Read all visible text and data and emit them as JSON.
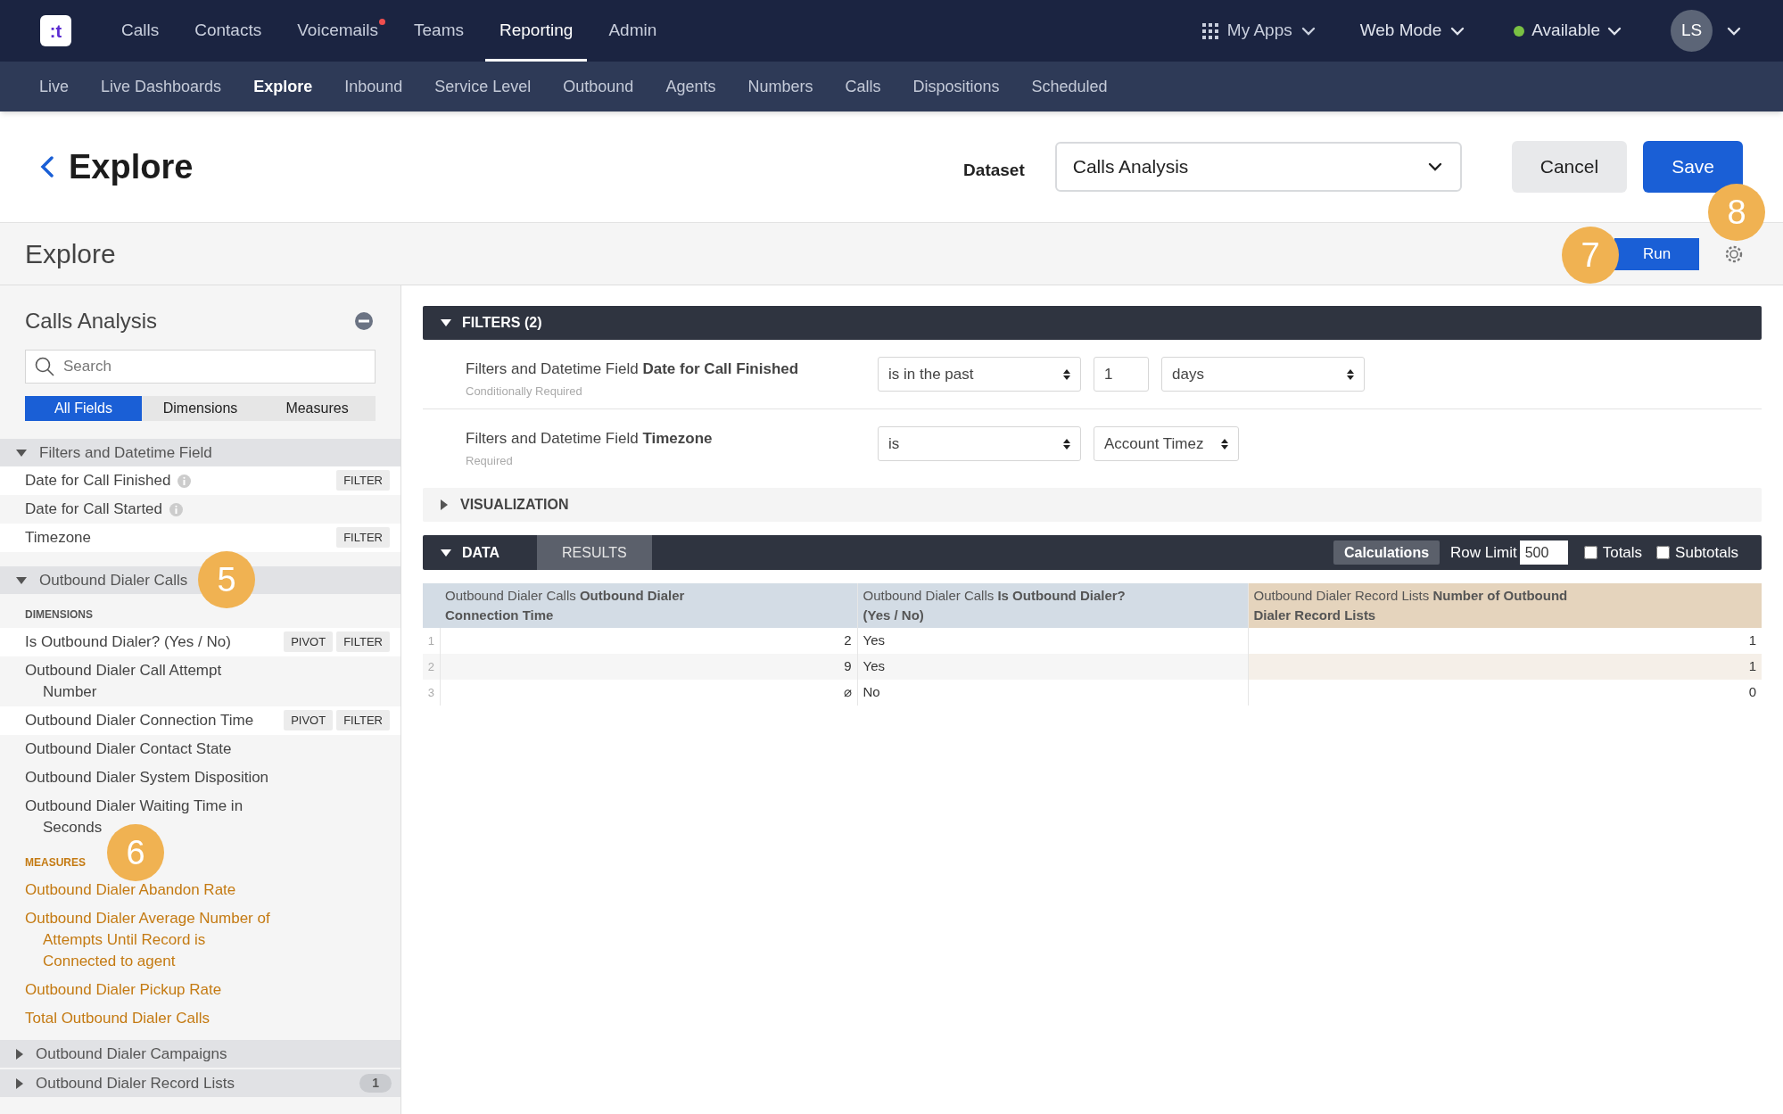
{
  "top_nav": {
    "logo_text": ":t",
    "items": [
      {
        "label": "Calls",
        "selected": false,
        "notification": false
      },
      {
        "label": "Contacts",
        "selected": false,
        "notification": false
      },
      {
        "label": "Voicemails",
        "selected": false,
        "notification": true
      },
      {
        "label": "Teams",
        "selected": false,
        "notification": false
      },
      {
        "label": "Reporting",
        "selected": true,
        "notification": false
      },
      {
        "label": "Admin",
        "selected": false,
        "notification": false
      }
    ],
    "apps": "My Apps",
    "mode": "Web Mode",
    "status": {
      "label": "Available",
      "color": "#7ac143"
    },
    "avatar": "LS"
  },
  "sub_nav": {
    "items": [
      {
        "label": "Live",
        "selected": false
      },
      {
        "label": "Live Dashboards",
        "selected": false
      },
      {
        "label": "Explore",
        "selected": true
      },
      {
        "label": "Inbound",
        "selected": false
      },
      {
        "label": "Service Level",
        "selected": false
      },
      {
        "label": "Outbound",
        "selected": false
      },
      {
        "label": "Agents",
        "selected": false
      },
      {
        "label": "Numbers",
        "selected": false
      },
      {
        "label": "Calls",
        "selected": false
      },
      {
        "label": "Dispositions",
        "selected": false
      },
      {
        "label": "Scheduled",
        "selected": false
      }
    ]
  },
  "page_header": {
    "title": "Explore",
    "dataset_label": "Dataset",
    "dataset_value": "Calls Analysis",
    "buttons": [
      {
        "label": "Cancel",
        "kind": "secondary"
      },
      {
        "label": "Save",
        "kind": "primary"
      }
    ]
  },
  "toolbar": {
    "title": "Explore",
    "run_button": "Run"
  },
  "sidebar": {
    "title": "Calls Analysis",
    "search": {
      "placeholder": "Search"
    },
    "tabs": [
      {
        "label": "All Fields",
        "selected": true
      },
      {
        "label": "Dimensions",
        "selected": false
      },
      {
        "label": "Measures",
        "selected": false
      }
    ],
    "sections": [
      {
        "title": "Filters and Datetime Field",
        "expanded": true,
        "groups": [
          {
            "kind": "dimension",
            "fields": [
              {
                "label": "Date for Call Finished",
                "info": true,
                "buttons": [
                  "FILTER"
                ]
              },
              {
                "label": "Date for Call Started",
                "info": true
              },
              {
                "label": "Timezone",
                "buttons": [
                  "FILTER"
                ]
              }
            ]
          }
        ]
      },
      {
        "title": "Outbound Dialer Calls",
        "expanded": true,
        "groups": [
          {
            "kind": "dimension",
            "heading": "DIMENSIONS",
            "fields": [
              {
                "label": "Is Outbound Dialer? (Yes / No)",
                "buttons": [
                  "PIVOT",
                  "FILTER"
                ]
              },
              {
                "label": "Outbound Dialer Call Attempt Number"
              },
              {
                "label": "Outbound Dialer Connection Time",
                "buttons": [
                  "PIVOT",
                  "FILTER"
                ]
              },
              {
                "label": "Outbound Dialer Contact State"
              },
              {
                "label": "Outbound Dialer System Disposition"
              },
              {
                "label": "Outbound Dialer Waiting Time in Seconds"
              }
            ]
          },
          {
            "kind": "measure",
            "heading": "MEASURES",
            "fields": [
              {
                "label": "Outbound Dialer Abandon Rate"
              },
              {
                "label": "Outbound Dialer Average Number of Attempts Until Record is Connected to agent"
              },
              {
                "label": "Outbound Dialer Pickup Rate"
              },
              {
                "label": "Total Outbound Dialer Calls"
              }
            ]
          }
        ]
      },
      {
        "title": "Outbound Dialer Campaigns",
        "expanded": false
      },
      {
        "title": "Outbound Dialer Record Lists",
        "expanded": false,
        "badge": "1"
      }
    ]
  },
  "filters": {
    "title": "FILTERS (2)",
    "expanded": true,
    "rows": [
      {
        "label": "Filters and Datetime Field **Date for Call Finished**",
        "note": "Conditionally Required",
        "controls": [
          {
            "kind": "select",
            "value": "is in the past"
          },
          {
            "kind": "input",
            "value": "1"
          },
          {
            "kind": "select",
            "value": "days"
          }
        ]
      },
      {
        "label": "Filters and Datetime Field **Timezone**",
        "note": "Required",
        "controls": [
          {
            "kind": "select",
            "value": "is"
          },
          {
            "kind": "select_short",
            "value": "Account Timez"
          }
        ]
      }
    ]
  },
  "visualization": {
    "title": "VISUALIZATION",
    "expanded": false
  },
  "data": {
    "expanded": true,
    "tabs": [
      {
        "label": "DATA",
        "selected": true
      },
      {
        "label": "RESULTS",
        "selected": false
      }
    ],
    "calculations": "Calculations",
    "row_limit": {
      "label": "Row Limit",
      "value": "500"
    },
    "checkboxes": [
      {
        "label": "Totals",
        "checked": false
      },
      {
        "label": "Subtotals",
        "checked": false
      }
    ],
    "table": {
      "columns": [
        {
          "label": "Outbound Dialer Calls **Outbound Dialer Connection Time**",
          "kind": "dimension"
        },
        {
          "label": "Outbound Dialer Calls **Is Outbound Dialer? (Yes / No)**",
          "kind": "dimension"
        },
        {
          "label": "Outbound Dialer Record Lists **Number of Outbound Dialer Record Lists**",
          "kind": "measure"
        }
      ],
      "rows": [
        {
          "number": "1",
          "cells": [
            "2",
            "Yes",
            "1"
          ]
        },
        {
          "number": "2",
          "cells": [
            "9",
            "Yes",
            "1"
          ]
        },
        {
          "number": "3",
          "cells": [
            "⌀",
            "No",
            "0"
          ]
        }
      ]
    }
  },
  "callouts": [
    {
      "label": "5"
    },
    {
      "label": "6"
    },
    {
      "label": "7"
    },
    {
      "label": "8"
    }
  ]
}
